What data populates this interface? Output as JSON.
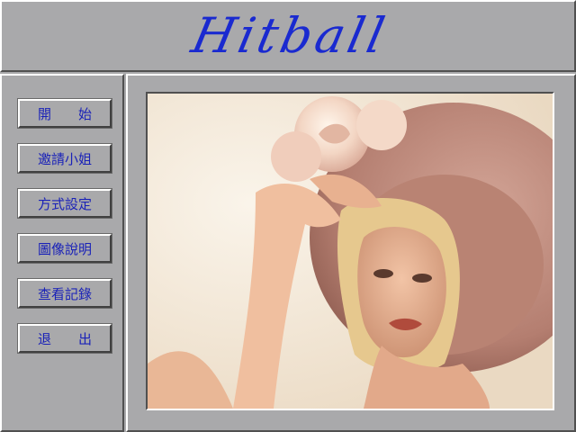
{
  "header": {
    "title": "Hitball"
  },
  "menu": {
    "items": [
      {
        "id": "start",
        "label": "開　　始"
      },
      {
        "id": "invite",
        "label": "邀請小姐"
      },
      {
        "id": "settings",
        "label": "方式設定"
      },
      {
        "id": "image-info",
        "label": "圖像說明"
      },
      {
        "id": "records",
        "label": "查看記錄"
      },
      {
        "id": "exit",
        "label": "退　　出"
      }
    ]
  },
  "colors": {
    "background": "#a9a9ab",
    "title": "#1a2ad0",
    "button_text": "#1a22b8"
  },
  "image": {
    "subject": "woman-in-pink-hat-with-rose"
  }
}
